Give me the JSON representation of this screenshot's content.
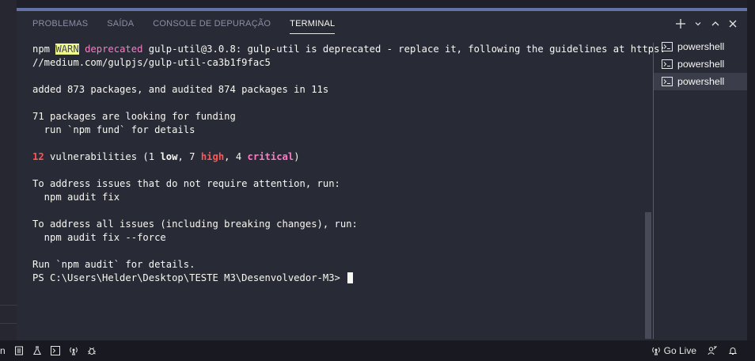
{
  "tabs": [
    {
      "label": "PROBLEMAS"
    },
    {
      "label": "SAÍDA"
    },
    {
      "label": "CONSOLE DE DEPURAÇÃO"
    },
    {
      "label": "TERMINAL"
    }
  ],
  "terminal": {
    "warn_prefix": "npm ",
    "warn_tag": "WARN",
    "deprecated_word": "deprecated",
    "warn_msg": "gulp-util@3.0.8: gulp-util is deprecated - replace it, following the guidelines at https:",
    "warn_url": "//medium.com/gulpjs/gulp-util-ca3b1f9fac5",
    "added": "added 873 packages, and audited 874 packages in 11s",
    "funding1": "71 packages are looking for funding",
    "funding2": "  run `npm fund` for details",
    "vuln_count": "12",
    "vuln_text_a": " vulnerabilities (1 ",
    "vuln_low": "low",
    "vuln_text_b": ", 7 ",
    "vuln_high": "high",
    "vuln_text_c": ", 4 ",
    "vuln_critical": "critical",
    "vuln_text_d": ")",
    "address1": "To address issues that do not require attention, run:",
    "address1_cmd": "  npm audit fix",
    "address2": "To address all issues (including breaking changes), run:",
    "address2_cmd": "  npm audit fix --force",
    "run_audit": "Run `npm audit` for details.",
    "prompt": "PS C:\\Users\\Helder\\Desktop\\TESTE M3\\Desenvolvedor-M3>"
  },
  "shells": [
    {
      "label": "powershell"
    },
    {
      "label": "powershell"
    },
    {
      "label": "powershell"
    }
  ],
  "status": {
    "left_char": "n",
    "go_live": "Go Live"
  },
  "colors": {
    "accent": "#6272a4",
    "warn_bg": "#f1fa8c",
    "deprecated": "#ff79c6",
    "high": "#ff5555",
    "critical": "#ff79c6"
  }
}
